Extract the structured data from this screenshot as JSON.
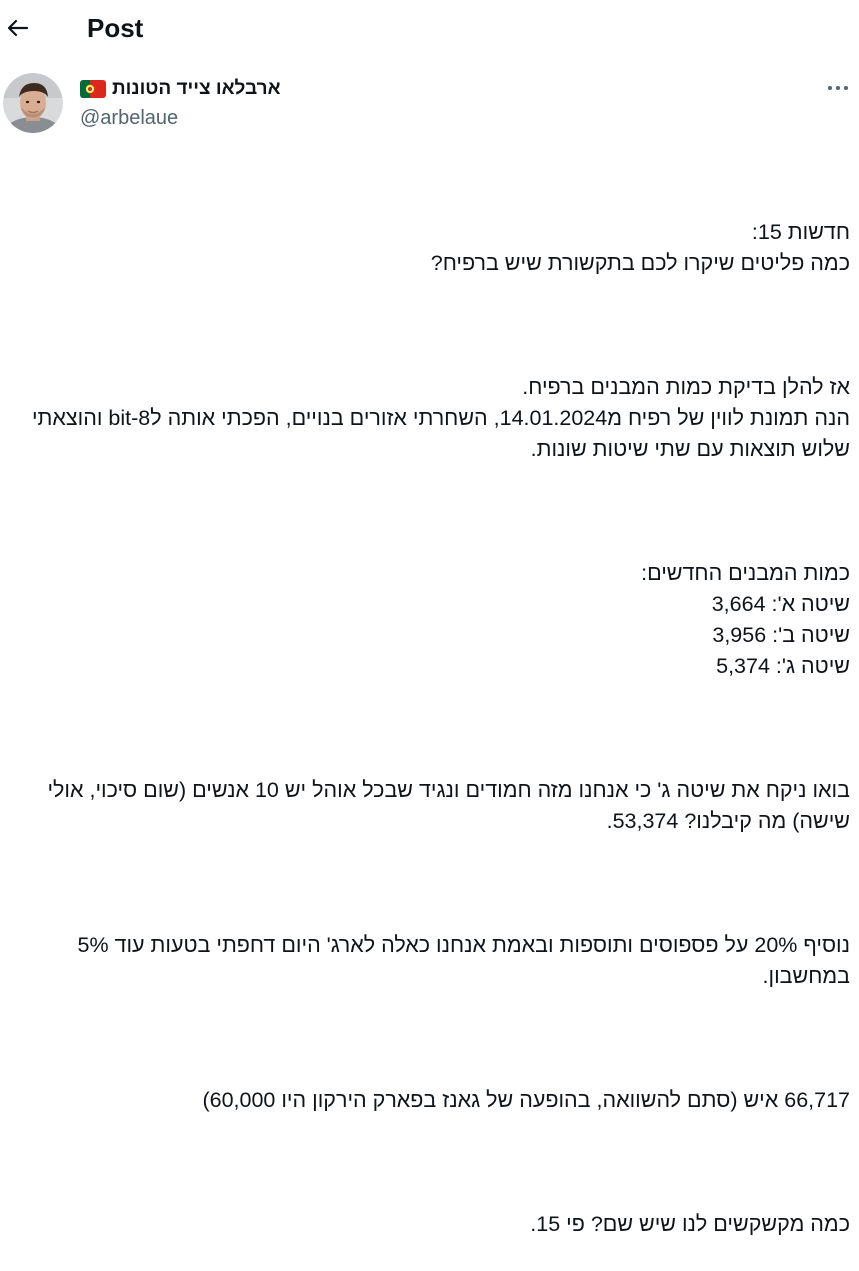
{
  "header": {
    "title": "Post"
  },
  "author": {
    "display_name": "ארבלאו צייד הטונות",
    "handle": "@arbelaue",
    "flag_icon": "portugal-flag-icon",
    "avatar_icon": "profile-photo"
  },
  "colors": {
    "text": "#0f1419",
    "secondary_text": "#536471",
    "background": "#ffffff"
  },
  "tweet": {
    "paragraphs": [
      "חדשות 15:\nכמה פליטים שיקרו לכם בתקשורת שיש ברפיח?",
      "אז להלן בדיקת כמות המבנים ברפיח.\nהנה תמונת לווין של רפיח מ14.01.2024, השחרתי אזורים בנויים, הפכתי אותה ל8-bit והוצאתי שלוש תוצאות עם שתי שיטות שונות.",
      "כמות המבנים החדשים:\nשיטה א': 3,664\nשיטה ב': 3,956\nשיטה ג': 5,374",
      "בואו ניקח את שיטה ג' כי אנחנו מזה חמודים ונגיד שבכל אוהל יש 10 אנשים (שום סיכוי, אולי שישה) מה קיבלנו? 53,374.",
      "נוסיף 20% על פספוסים ותוספות ובאמת אנחנו כאלה לארג' היום דחפתי בטעות עוד 5% במחשבון.",
      "66,717 איש (סתם להשוואה, בהופעה של גאנז בפארק הירקון היו 60,000)",
      "כמה מקשקשים לנו שיש שם? פי 15."
    ]
  }
}
